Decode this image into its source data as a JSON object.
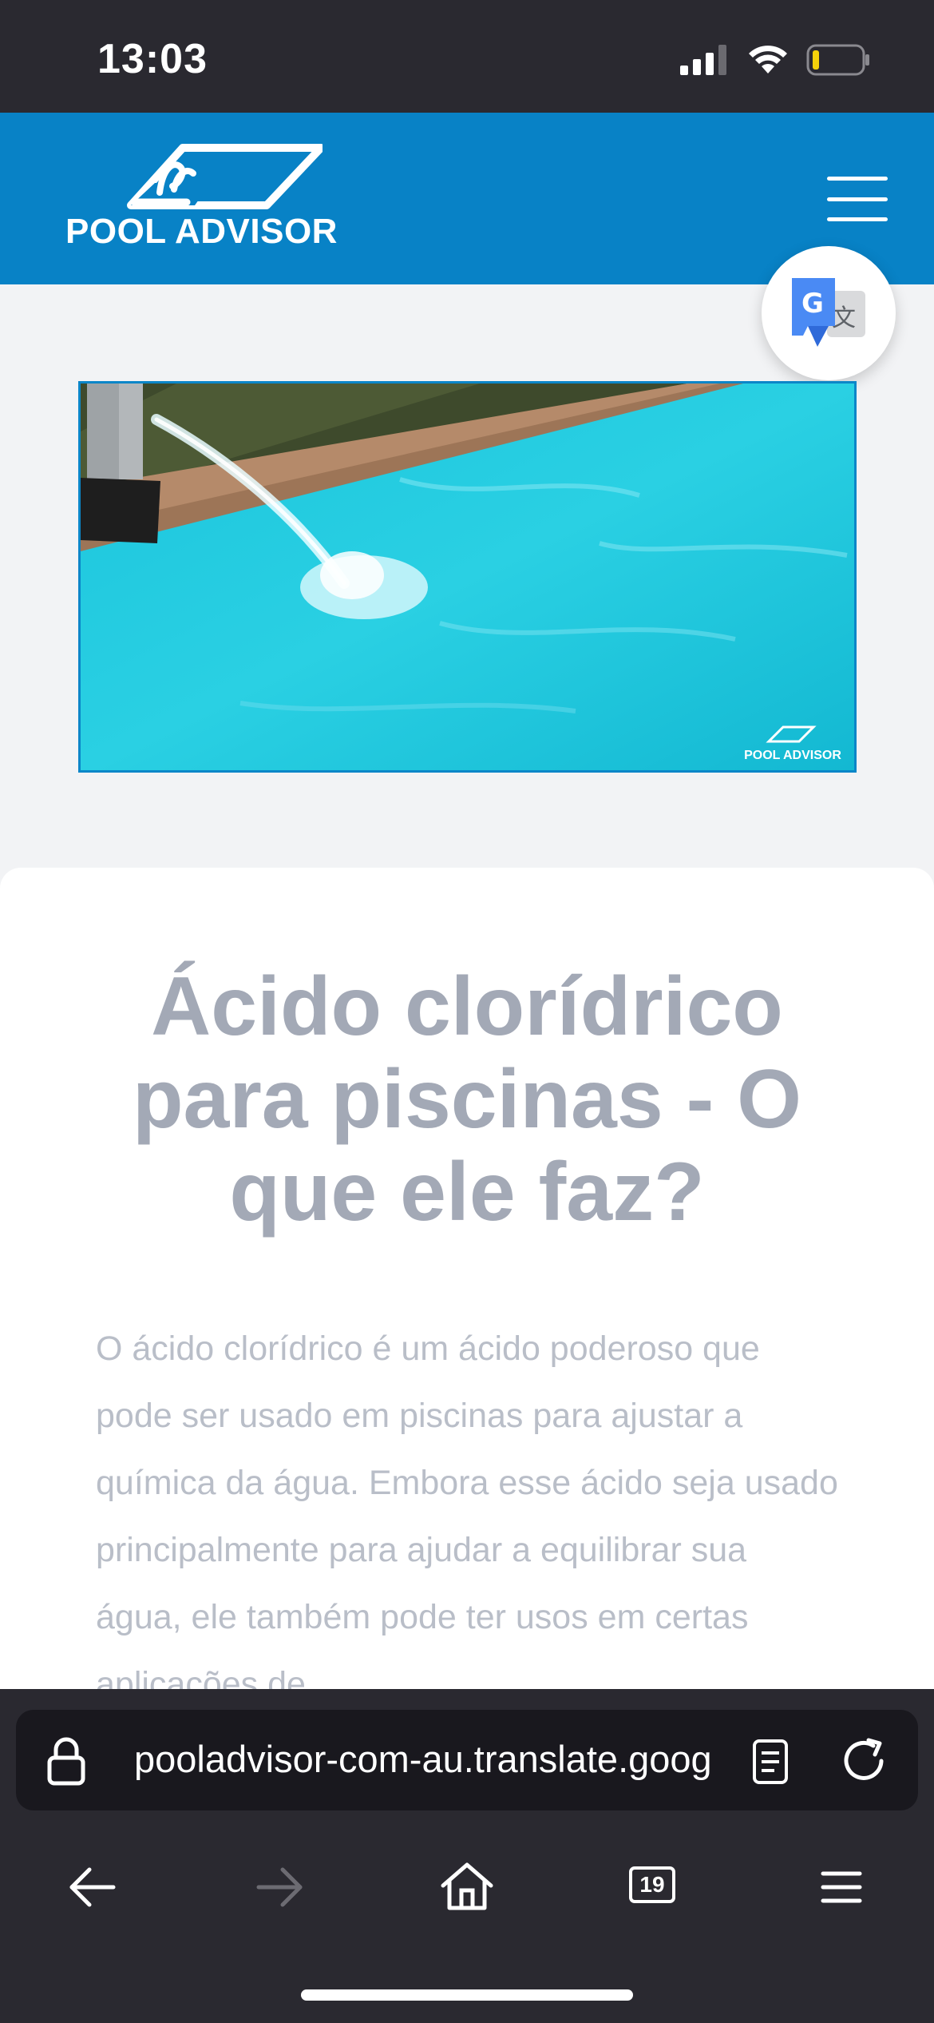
{
  "status_bar": {
    "time": "13:03",
    "icons": [
      "cellular-signal-icon",
      "wifi-icon",
      "battery-icon"
    ],
    "battery_level": 0.1
  },
  "header": {
    "logo_text": "POOL ADVISOR",
    "menu_icon": "hamburger-icon",
    "background_color": "#0882c6"
  },
  "translate_button": {
    "icon": "google-translate-icon"
  },
  "hero": {
    "image_description_icon": "pool-water-image",
    "watermark": "POOL ADVISOR"
  },
  "article": {
    "title": "Ácido clorídrico para piscinas - O que ele faz?",
    "intro": "O ácido clorídrico é um ácido poderoso que pode ser usado em piscinas para ajustar a química da água. Embora esse ácido seja usado principalmente para ajudar a equilibrar sua água, ele também pode ter usos em certas aplicações de"
  },
  "browser": {
    "url": "pooladvisor-com-au.translate.goog",
    "tab_count": "19",
    "icons": {
      "lock": "lock-icon",
      "reader": "reader-mode-icon",
      "reload": "reload-icon",
      "back": "back-arrow-icon",
      "forward": "forward-arrow-icon",
      "home": "home-icon",
      "tabs": "tabs-icon",
      "menu": "menu-icon"
    }
  },
  "colors": {
    "status_bar": "#2a2930",
    "header": "#0882c6",
    "title": "#a3a9b6",
    "body": "#b9bec8"
  }
}
